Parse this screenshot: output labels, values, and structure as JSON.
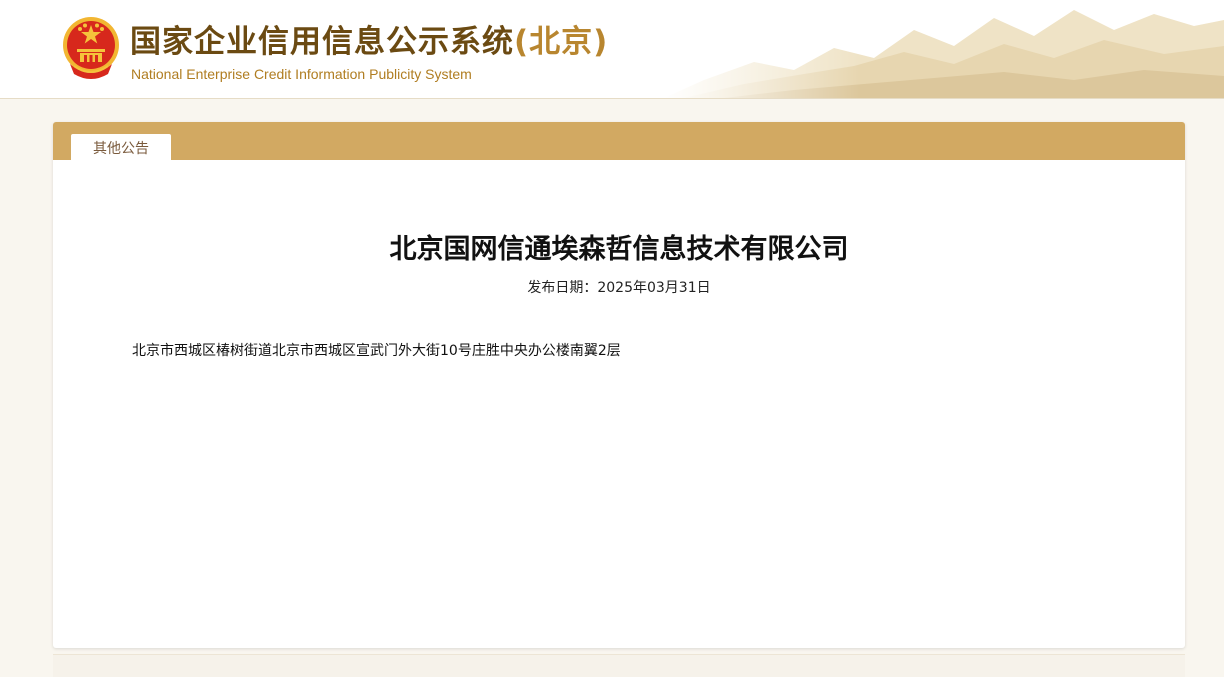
{
  "header": {
    "title_cn": "国家企业信用信息公示系统",
    "title_region": "(北京)",
    "title_en": "National Enterprise Credit Information Publicity System"
  },
  "tabs": [
    {
      "label": "其他公告",
      "active": true
    }
  ],
  "notice": {
    "company_name": "北京国网信通埃森哲信息技术有限公司",
    "date_label": "发布日期：",
    "date_value": "2025年03月31日",
    "address": "北京市西城区椿树街道北京市西城区宣武门外大街10号庄胜中央办公楼南翼2层"
  },
  "colors": {
    "tab_bar": "#d2a962",
    "title_dark": "#6b4a12",
    "title_gold": "#b8862f",
    "emblem_red": "#d7281c",
    "emblem_gold": "#f5c33b"
  },
  "icons": {
    "emblem": "national-emblem-icon"
  }
}
